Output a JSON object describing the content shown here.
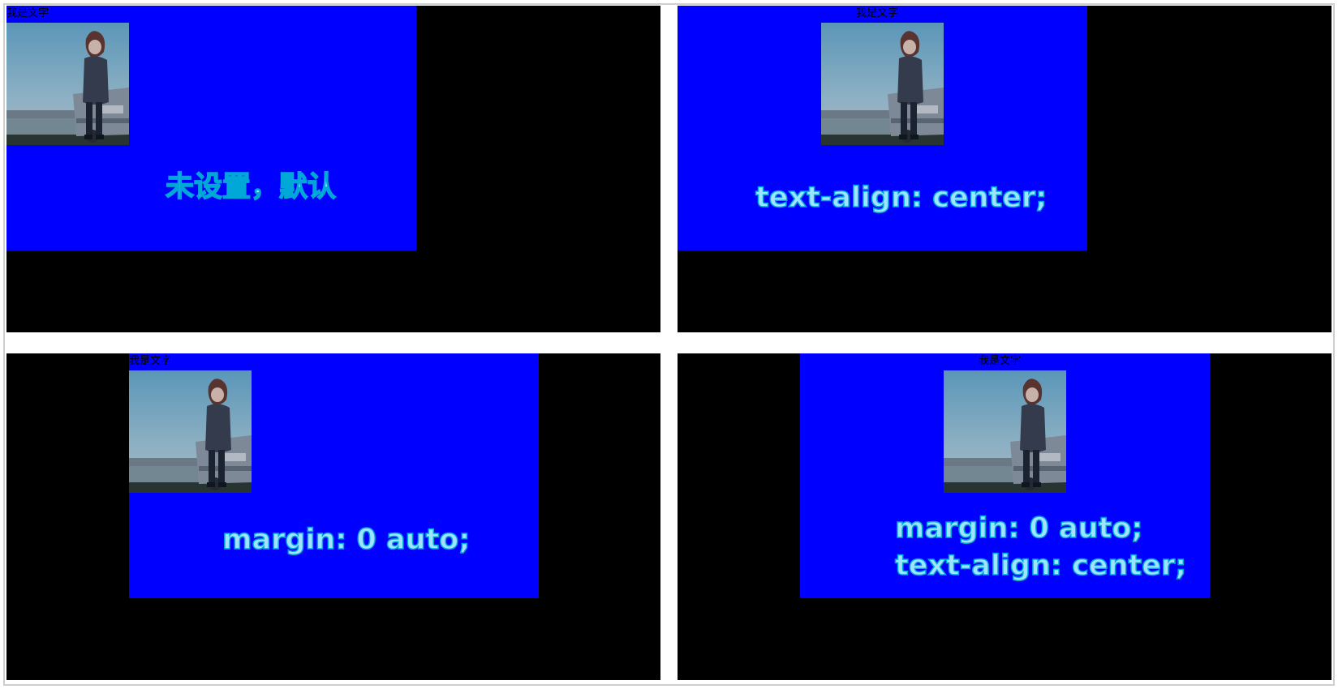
{
  "panels": [
    {
      "label": "我是文字",
      "caption_lines": [
        "未设置，默认"
      ]
    },
    {
      "label": "我是文字",
      "caption_lines": [
        "text-align: center;"
      ]
    },
    {
      "label": "我是文字",
      "caption_lines": [
        "margin: 0 auto;"
      ]
    },
    {
      "label": "我是文字",
      "caption_lines": [
        "margin: 0 auto;",
        "text-align: center;"
      ]
    }
  ],
  "colors": {
    "panel_background": "#000000",
    "box_background": "#0000ff",
    "caption_fill": "#9fe3ff",
    "caption_outline": "#00a8d8",
    "label_color": "#000000"
  },
  "image": {
    "icon": "anime-girl-by-car-picture"
  }
}
